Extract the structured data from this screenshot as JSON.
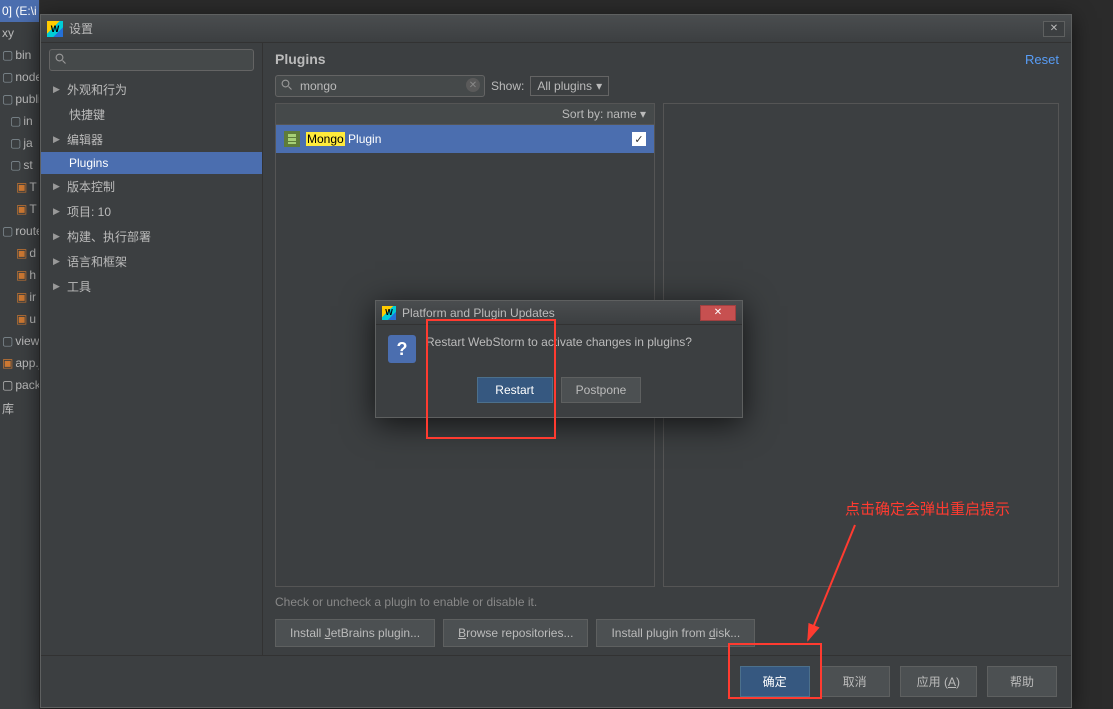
{
  "bgTree": {
    "header": "0] (E:\\i",
    "items": [
      {
        "label": "xy"
      },
      {
        "label": "bin",
        "icon": "folder"
      },
      {
        "label": "node",
        "icon": "folder"
      },
      {
        "label": "publi",
        "icon": "folder"
      },
      {
        "label": "in",
        "icon": "folder",
        "indent": true
      },
      {
        "label": "ja",
        "icon": "folder",
        "indent": true
      },
      {
        "label": "st",
        "icon": "folder",
        "indent": true
      },
      {
        "label": "T",
        "icon": "js",
        "indent": true
      },
      {
        "label": "T",
        "icon": "js",
        "indent": true
      },
      {
        "label": "route",
        "icon": "folder"
      },
      {
        "label": "d",
        "icon": "js",
        "indent": true
      },
      {
        "label": "h",
        "icon": "js",
        "indent": true
      },
      {
        "label": "ir",
        "icon": "js",
        "indent": true
      },
      {
        "label": "u",
        "icon": "js",
        "indent": true
      },
      {
        "label": "views",
        "icon": "folder"
      },
      {
        "label": "app.j",
        "icon": "js"
      },
      {
        "label": "pack",
        "icon": "file"
      },
      {
        "label": "库"
      }
    ]
  },
  "dialog": {
    "title": "设置",
    "sidebar": {
      "items": [
        {
          "label": "外观和行为",
          "hasChildren": true
        },
        {
          "label": "快捷键",
          "hasChildren": false,
          "child": true
        },
        {
          "label": "编辑器",
          "hasChildren": true
        },
        {
          "label": "Plugins",
          "hasChildren": false,
          "child": true,
          "selected": true
        },
        {
          "label": "版本控制",
          "hasChildren": true
        },
        {
          "label": "项目: 10",
          "hasChildren": true
        },
        {
          "label": "构建、执行部署",
          "hasChildren": true
        },
        {
          "label": "语言和框架",
          "hasChildren": true
        },
        {
          "label": "工具",
          "hasChildren": true
        }
      ]
    },
    "main": {
      "title": "Plugins",
      "reset": "Reset",
      "search_value": "mongo",
      "show_label": "Show:",
      "show_value": "All plugins",
      "sort_label": "Sort by: name",
      "plugin": {
        "highlight": "Mongo",
        "rest": " Plugin",
        "checked": true
      },
      "hint": "Check or uncheck a plugin to enable or disable it.",
      "buttons": {
        "install_jb": "Install JetBrains plugin...",
        "browse": "Browse repositories...",
        "install_disk": "Install plugin from disk..."
      }
    },
    "footer": {
      "ok": "确定",
      "cancel": "取消",
      "apply_pre": "应用 (",
      "apply_key": "A",
      "apply_post": ")",
      "help": "帮助"
    }
  },
  "modal": {
    "title": "Platform and Plugin Updates",
    "message": "Restart WebStorm to activate changes in plugins?",
    "restart": "Restart",
    "postpone": "Postpone"
  },
  "annotation": {
    "text": "点击确定会弹出重启提示"
  },
  "browse_u": "B",
  "browse_rest": "rowse repositories...",
  "install_j_pre": "Install ",
  "install_j_u": "J",
  "install_j_post": "etBrains plugin...",
  "disk_pre": "Install plugin from ",
  "disk_u": "d",
  "disk_post": "isk..."
}
